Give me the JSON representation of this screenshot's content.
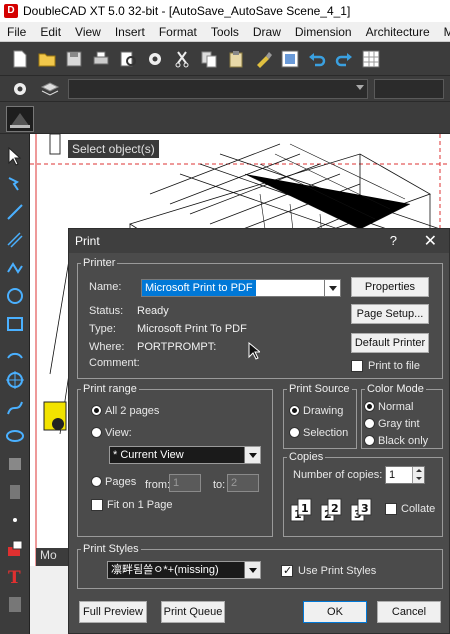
{
  "window": {
    "title": "DoubleCAD XT 5.0 32-bit - [AutoSave_AutoSave Scene_4_1]"
  },
  "menu": [
    "File",
    "Edit",
    "View",
    "Insert",
    "Format",
    "Tools",
    "Draw",
    "Dimension",
    "Architecture",
    "Modify"
  ],
  "toolbar": {
    "icons": [
      "new-icon",
      "open-icon",
      "save-icon",
      "print-icon",
      "print-preview-icon",
      "gear-icon",
      "cut-icon",
      "copy-icon",
      "paste-icon",
      "brush-icon",
      "snap-icon",
      "undo-icon",
      "redo-icon",
      "grid-icon"
    ]
  },
  "canvas": {
    "hint": "Select object(s)"
  },
  "bottom_tab": "Mo",
  "dialog": {
    "title": "Print",
    "help": "?",
    "close": "✕",
    "printer": {
      "legend": "Printer",
      "name_label": "Name:",
      "name_value": "Microsoft Print to PDF",
      "status_label": "Status:",
      "status_value": "Ready",
      "type_label": "Type:",
      "type_value": "Microsoft Print To PDF",
      "where_label": "Where:",
      "where_value": "PORTPROMPT:",
      "comment_label": "Comment:",
      "comment_value": "",
      "properties_btn": "Properties",
      "page_setup_btn": "Page Setup...",
      "default_printer_btn": "Default Printer",
      "print_to_file_label": "Print to file",
      "print_to_file_checked": false
    },
    "print_range": {
      "legend": "Print range",
      "all_pages_label": "All 2 pages",
      "view_label": "View:",
      "view_value": "* Current View",
      "pages_label": "Pages",
      "from_label": "from:",
      "from_value": "1",
      "to_label": "to:",
      "to_value": "2",
      "fit_label": "Fit on 1 Page",
      "selected": "all",
      "fit_checked": false
    },
    "print_source": {
      "legend": "Print Source",
      "drawing_label": "Drawing",
      "selection_label": "Selection",
      "selected": "drawing"
    },
    "color_mode": {
      "legend": "Color Mode",
      "normal_label": "Normal",
      "gray_label": "Gray tint",
      "black_label": "Black only",
      "selected": "normal"
    },
    "copies": {
      "legend": "Copies",
      "number_label": "Number of copies:",
      "number_value": "1",
      "collate_label": "Collate",
      "collate_checked": false
    },
    "print_styles": {
      "legend": "Print Styles",
      "style_value": "凛畔됨쓸ㅇ*+(missing)",
      "use_label": "Use Print Styles",
      "use_checked": true
    },
    "buttons": {
      "full_preview": "Full Preview",
      "print_queue": "Print Queue",
      "ok": "OK",
      "cancel": "Cancel"
    }
  }
}
